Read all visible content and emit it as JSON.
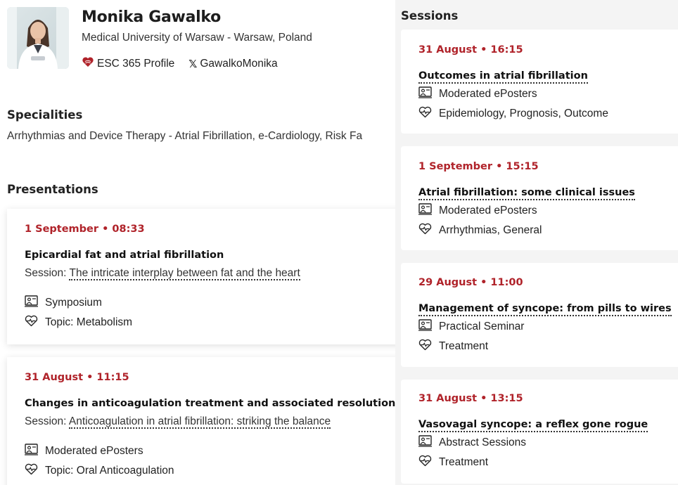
{
  "profile": {
    "name": "Monika Gawalko",
    "affiliation": "Medical University of Warsaw - Warsaw, Poland",
    "esc_profile_label": "ESC 365 Profile",
    "twitter_handle": "GawalkoMonika"
  },
  "specialities": {
    "heading": "Specialities",
    "text": "Arrhythmias and Device Therapy - Atrial Fibrillation, e-Cardiology, Risk Fa"
  },
  "presentations": {
    "heading": "Presentations",
    "session_prefix": "Session:",
    "items": [
      {
        "date": "1 September • 08:33",
        "title": "Epicardial fat and atrial fibrillation",
        "session": "The intricate interplay between fat and the heart",
        "type": "Symposium",
        "topic": "Topic: Metabolism"
      },
      {
        "date": "31 August • 11:15",
        "title": "Changes in anticoagulation treatment and associated resolution",
        "session": "Anticoagulation in atrial fibrillation: striking the balance",
        "type": "Moderated ePosters",
        "topic": "Topic: Oral Anticoagulation"
      }
    ]
  },
  "sessions": {
    "heading": "Sessions",
    "items": [
      {
        "date": "31 August • 16:15",
        "title": "Outcomes in atrial fibrillation",
        "type": "Moderated ePosters",
        "topic": "Epidemiology, Prognosis, Outcome"
      },
      {
        "date": "1 September • 15:15",
        "title": "Atrial fibrillation: some clinical issues",
        "type": "Moderated ePosters",
        "topic": "Arrhythmias, General"
      },
      {
        "date": "29 August • 11:00",
        "title": "Management of syncope: from pills to wires",
        "type": "Practical Seminar",
        "topic": "Treatment"
      },
      {
        "date": "31 August • 13:15",
        "title": "Vasovagal syncope: a reflex gone rogue",
        "type": "Abstract Sessions",
        "topic": "Treatment"
      }
    ]
  },
  "icons": {
    "session_type": "presenter-board-icon",
    "topic": "heart-pulse-icon",
    "esc": "esc-heart-logo-icon",
    "twitter": "x-logo-icon"
  },
  "colors": {
    "accent_red": "#b0232a",
    "page_bg": "#f4f4f4",
    "card_bg": "#ffffff"
  }
}
